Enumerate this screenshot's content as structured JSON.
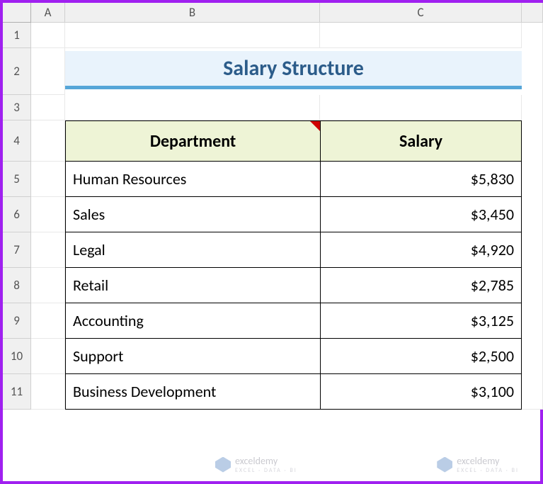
{
  "columns": [
    "A",
    "B",
    "C"
  ],
  "rows": [
    "1",
    "2",
    "3",
    "4",
    "5",
    "6",
    "7",
    "8",
    "9",
    "10",
    "11"
  ],
  "title": "Salary Structure",
  "headers": {
    "department": "Department",
    "salary": "Salary"
  },
  "chart_data": {
    "type": "table",
    "title": "Salary Structure",
    "columns": [
      "Department",
      "Salary"
    ],
    "rows": [
      {
        "department": "Human Resources",
        "salary": "$5,830"
      },
      {
        "department": "Sales",
        "salary": "$3,450"
      },
      {
        "department": "Legal",
        "salary": "$4,920"
      },
      {
        "department": "Retail",
        "salary": "$2,785"
      },
      {
        "department": "Accounting",
        "salary": "$3,125"
      },
      {
        "department": "Support",
        "salary": "$2,500"
      },
      {
        "department": "Business Development",
        "salary": "$3,100"
      }
    ]
  },
  "watermark": {
    "brand": "exceldemy",
    "tagline": "EXCEL · DATA · BI"
  }
}
